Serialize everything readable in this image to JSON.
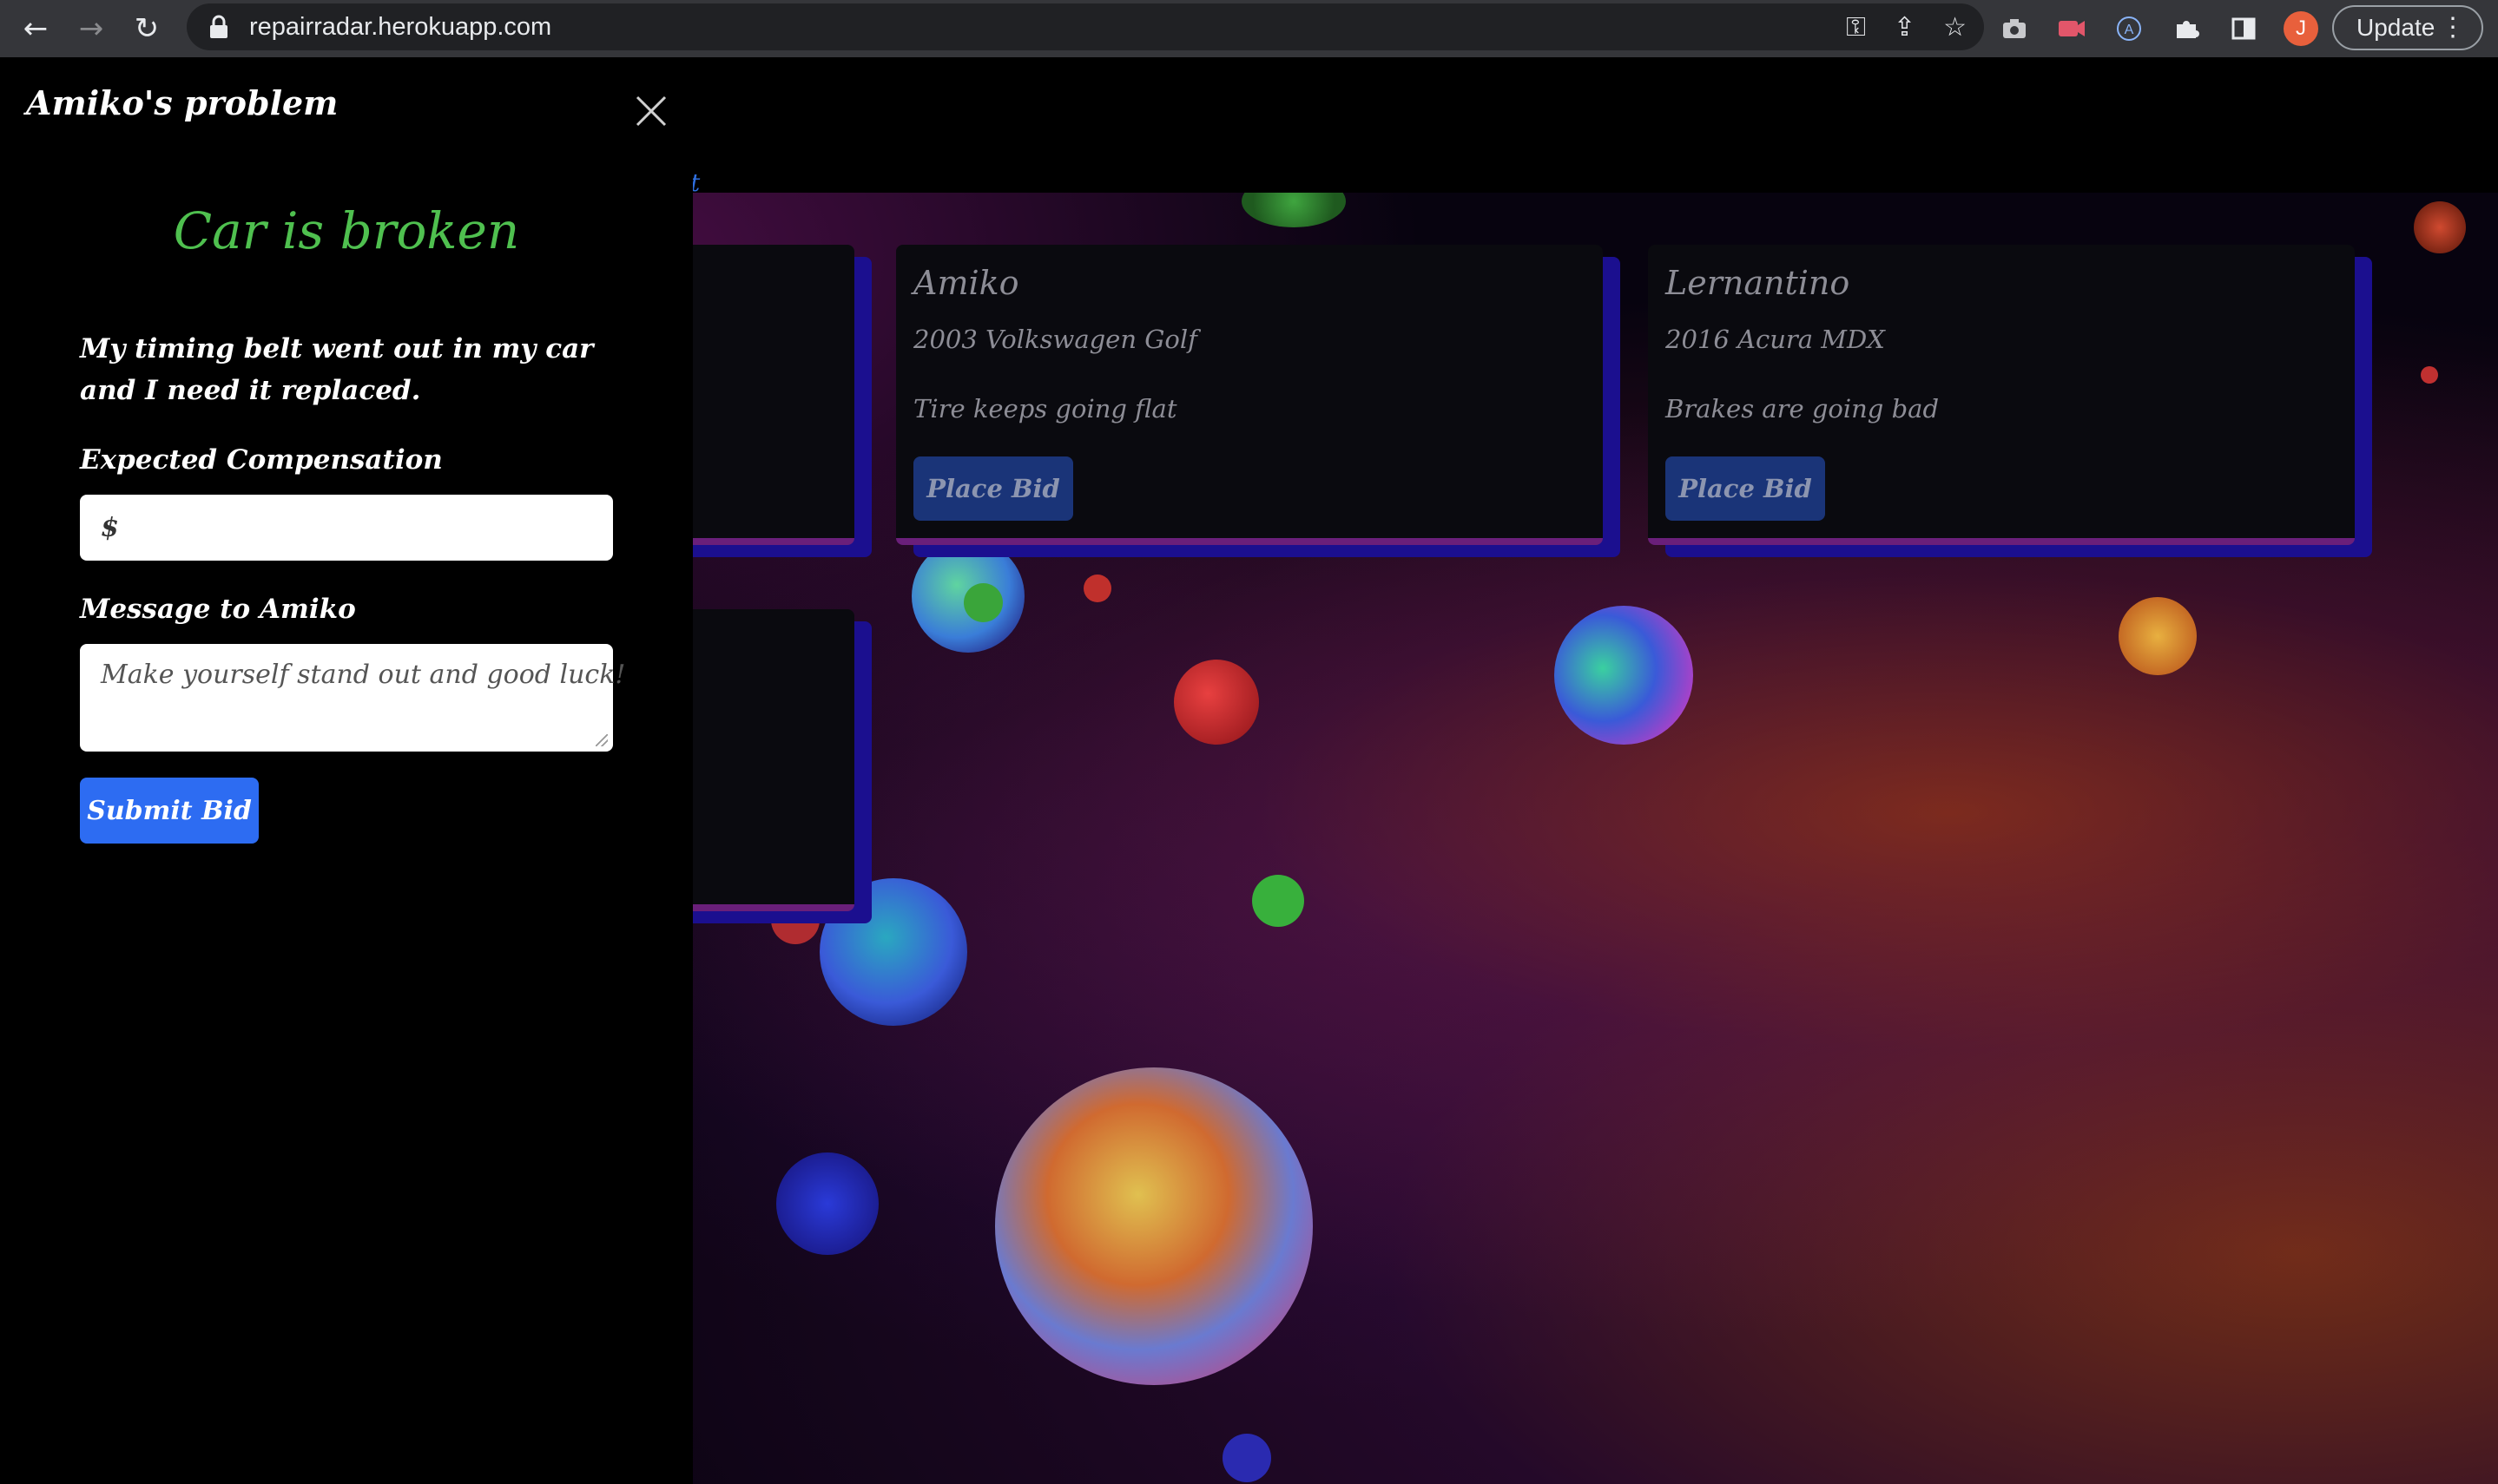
{
  "browser": {
    "url": "repairradar.herokuapp.com",
    "update_label": "Update",
    "avatar_initial": "J",
    "icons": [
      "back-icon",
      "forward-icon",
      "reload-icon",
      "lock-icon",
      "key-icon",
      "share-icon",
      "star-icon",
      "camera-icon",
      "record-icon",
      "account-circle-icon",
      "puzzle-icon",
      "sidepanel-icon",
      "menu-dots-icon"
    ]
  },
  "background": {
    "link_fragment": "t",
    "cards": [
      {
        "name": "Amiko",
        "car": "2003 Volkswagen Golf",
        "issue": "Tire keeps going flat",
        "button": "Place Bid"
      },
      {
        "name": "Lernantino",
        "car": "2016 Acura MDX",
        "issue": "Brakes are going bad",
        "button": "Place Bid"
      }
    ]
  },
  "panel": {
    "title": "Amiko's problem",
    "headline": "Car is broken",
    "description": "My timing belt went out in my car and I need it replaced.",
    "compensation_label": "Expected Compensation",
    "compensation_value": "$",
    "message_label": "Message to Amiko",
    "message_placeholder": "Make yourself stand out and good luck!",
    "submit_label": "Submit Bid"
  },
  "colors": {
    "headline": "#4fc04f",
    "submit": "#2d6cf2",
    "place_bid": "#1a3478",
    "card_shadow": "#1b0f8f"
  }
}
